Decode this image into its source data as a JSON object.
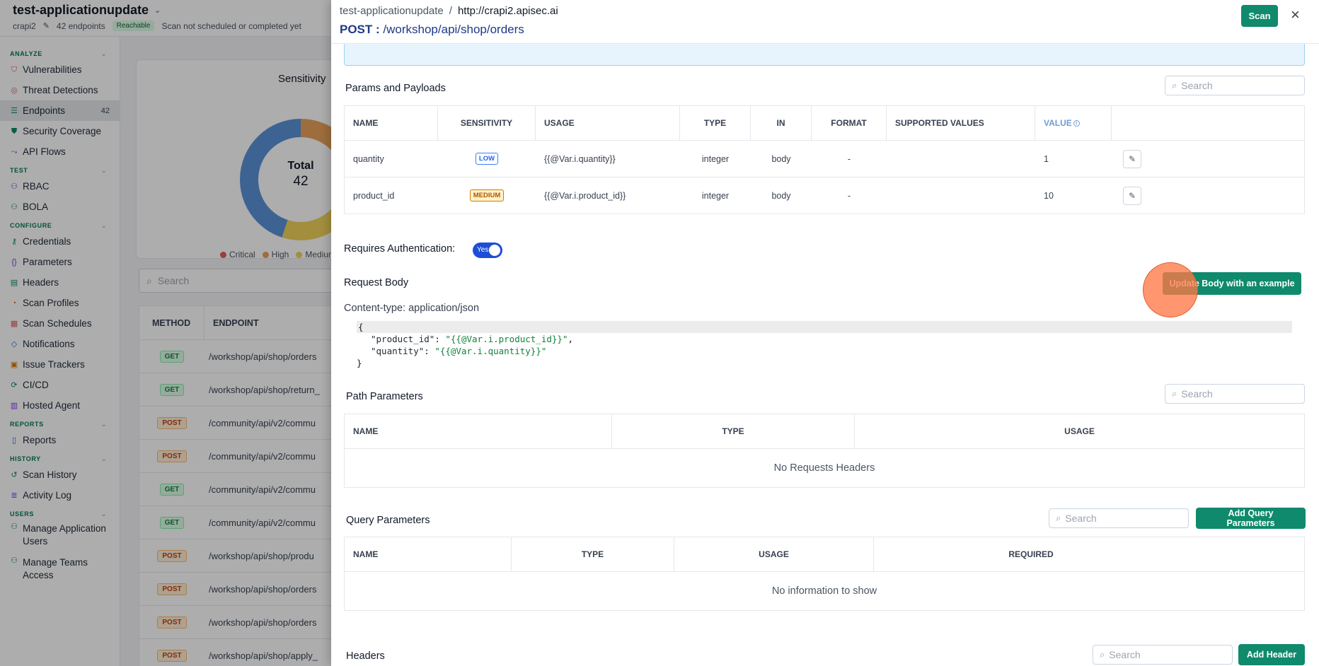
{
  "app": {
    "title": "test-applicationupdate",
    "project": "crapi2",
    "endpoint_count": "42 endpoints",
    "reachable": "Reachable",
    "scan_status": "Scan not scheduled or completed yet"
  },
  "sidebar": {
    "sections": [
      {
        "label": "ANALYZE",
        "items": [
          {
            "label": "Vulnerabilities",
            "icon": "shield-icon"
          },
          {
            "label": "Threat Detections",
            "icon": "target-icon"
          },
          {
            "label": "Endpoints",
            "icon": "list-icon",
            "count": "42",
            "active": true
          },
          {
            "label": "Security Coverage",
            "icon": "shield-check-icon"
          },
          {
            "label": "API Flows",
            "icon": "flow-icon"
          }
        ]
      },
      {
        "label": "TEST",
        "items": [
          {
            "label": "RBAC",
            "icon": "users-icon"
          },
          {
            "label": "BOLA",
            "icon": "user-icon"
          }
        ]
      },
      {
        "label": "CONFIGURE",
        "items": [
          {
            "label": "Credentials",
            "icon": "key-icon"
          },
          {
            "label": "Parameters",
            "icon": "braces-icon"
          },
          {
            "label": "Headers",
            "icon": "header-icon"
          },
          {
            "label": "Scan Profiles",
            "icon": "gauge-icon"
          },
          {
            "label": "Scan Schedules",
            "icon": "calendar-icon"
          },
          {
            "label": "Notifications",
            "icon": "bell-icon"
          },
          {
            "label": "Issue Trackers",
            "icon": "tracker-icon"
          },
          {
            "label": "CI/CD",
            "icon": "pipeline-icon"
          },
          {
            "label": "Hosted Agent",
            "icon": "server-icon"
          }
        ]
      },
      {
        "label": "REPORTS",
        "items": [
          {
            "label": "Reports",
            "icon": "file-icon"
          }
        ]
      },
      {
        "label": "HISTORY",
        "items": [
          {
            "label": "Scan History",
            "icon": "history-icon"
          },
          {
            "label": "Activity Log",
            "icon": "log-icon"
          }
        ]
      },
      {
        "label": "USERS",
        "items": [
          {
            "label": "Manage Application Users",
            "icon": "user-icon"
          },
          {
            "label": "Manage Teams Access",
            "icon": "team-icon"
          }
        ]
      }
    ]
  },
  "overview": {
    "card_title": "Sensitivity",
    "total_label": "Total",
    "total_value": "42",
    "legend": [
      {
        "label": "Critical",
        "color": "#e05d5d"
      },
      {
        "label": "High",
        "color": "#e8a15a"
      },
      {
        "label": "Medium",
        "color": "#f0d25c"
      }
    ],
    "search_placeholder": "Search",
    "table_headers": [
      "METHOD",
      "ENDPOINT"
    ],
    "rows": [
      {
        "method": "GET",
        "endpoint": "/workshop/api/shop/orders"
      },
      {
        "method": "GET",
        "endpoint": "/workshop/api/shop/return_"
      },
      {
        "method": "POST",
        "endpoint": "/community/api/v2/commu"
      },
      {
        "method": "POST",
        "endpoint": "/community/api/v2/commu"
      },
      {
        "method": "GET",
        "endpoint": "/community/api/v2/commu"
      },
      {
        "method": "GET",
        "endpoint": "/community/api/v2/commu"
      },
      {
        "method": "POST",
        "endpoint": "/workshop/api/shop/produ"
      },
      {
        "method": "POST",
        "endpoint": "/workshop/api/shop/orders"
      },
      {
        "method": "POST",
        "endpoint": "/workshop/api/shop/orders"
      },
      {
        "method": "POST",
        "endpoint": "/workshop/api/shop/apply_"
      }
    ]
  },
  "drawer": {
    "breadcrumb_app": "test-applicationupdate",
    "breadcrumb_sep": "/",
    "breadcrumb_url": "http://crapi2.apisec.ai",
    "method": "POST :",
    "path": "/workshop/api/shop/orders",
    "scan_label": "Scan",
    "close": "×"
  },
  "params": {
    "title": "Params and Payloads",
    "search_placeholder": "Search",
    "headers": [
      "NAME",
      "SENSITIVITY",
      "USAGE",
      "TYPE",
      "IN",
      "FORMAT",
      "SUPPORTED VALUES",
      "VALUE"
    ],
    "rows": [
      {
        "name": "quantity",
        "sensitivity": "LOW",
        "usage": "{{@Var.i.quantity}}",
        "type": "integer",
        "in": "body",
        "format": "-",
        "supported": "",
        "value": "1"
      },
      {
        "name": "product_id",
        "sensitivity": "MEDIUM",
        "usage": "{{@Var.i.product_id}}",
        "type": "integer",
        "in": "body",
        "format": "-",
        "supported": "",
        "value": "10"
      }
    ]
  },
  "auth": {
    "label": "Requires Authentication:",
    "toggle": "Yes"
  },
  "request_body": {
    "title": "Request Body",
    "update_label": "Update Body with an example",
    "content_type": "Content-type: application/json",
    "open": "{",
    "lines": [
      {
        "key": "\"product_id\"",
        "val": "\"{{@Var.i.product_id}}\"",
        "tail": ","
      },
      {
        "key": "\"quantity\"",
        "val": "\"{{@Var.i.quantity}}\"",
        "tail": ""
      }
    ],
    "close": "}"
  },
  "path_params": {
    "title": "Path Parameters",
    "search_placeholder": "Search",
    "headers": [
      "NAME",
      "TYPE",
      "USAGE"
    ],
    "empty": "No Requests Headers"
  },
  "query_params": {
    "title": "Query Parameters",
    "search_placeholder": "Search",
    "add_label": "Add Query Parameters",
    "headers": [
      "NAME",
      "TYPE",
      "USAGE",
      "REQUIRED"
    ],
    "empty": "No information to show"
  },
  "headers_section": {
    "title": "Headers",
    "search_placeholder": "Search",
    "add_label": "Add Header"
  }
}
